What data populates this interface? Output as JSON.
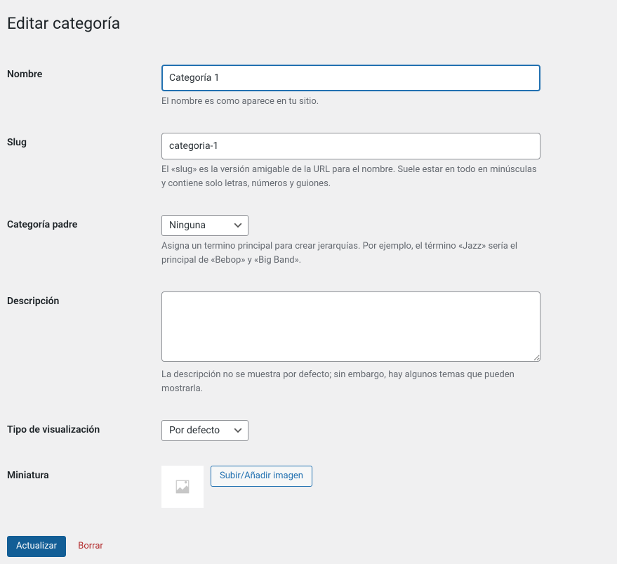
{
  "page": {
    "title": "Editar categoría"
  },
  "fields": {
    "name": {
      "label": "Nombre",
      "value": "Categoría 1",
      "description": "El nombre es como aparece en tu sitio."
    },
    "slug": {
      "label": "Slug",
      "value": "categoria-1",
      "description": "El «slug» es la versión amigable de la URL para el nombre. Suele estar en todo en minúsculas y contiene solo letras, números y guiones."
    },
    "parent": {
      "label": "Categoría padre",
      "selected": "Ninguna",
      "description": "Asigna un termino principal para crear jerarquías. Por ejemplo, el término «Jazz» sería el principal de «Bebop» y «Big Band»."
    },
    "description": {
      "label": "Descripción",
      "value": "",
      "description": "La descripción no se muestra por defecto; sin embargo, hay algunos temas que pueden mostrarla."
    },
    "display_type": {
      "label": "Tipo de visualización",
      "selected": "Por defecto"
    },
    "thumbnail": {
      "label": "Miniatura",
      "upload_button": "Subir/Añadir imagen"
    }
  },
  "actions": {
    "submit": "Actualizar",
    "delete": "Borrar"
  }
}
